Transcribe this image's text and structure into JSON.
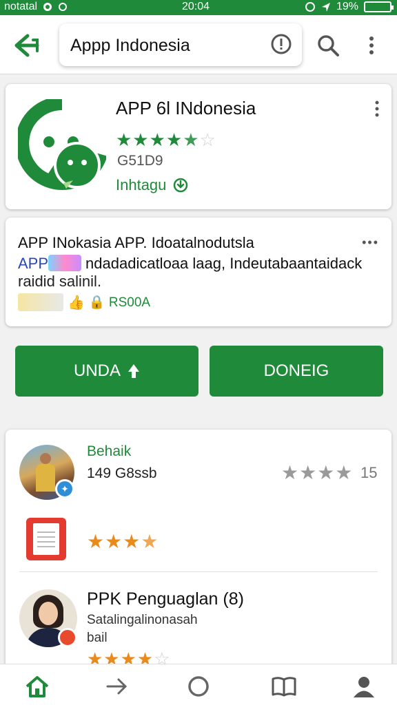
{
  "status_bar": {
    "carrier": "notatal",
    "time": "20:04",
    "battery": "19%"
  },
  "search": {
    "query": "Appp Indonesia"
  },
  "app": {
    "title": "APP 6l INdonesia",
    "rating_stars": 4.5,
    "code": "G51D9",
    "install_label": "Inhtagu"
  },
  "description": {
    "title": "APP INokasia APP. Idoatalnodutsla",
    "more": "•••",
    "app_tag": "APP",
    "line1": "ndadadicatloaa laag, Indeutabaantaidack",
    "line2": "raidid salinil.",
    "badge": "RS00A"
  },
  "buttons": {
    "left_label": "UNDA",
    "right_label": "DONEIG"
  },
  "reviews": [
    {
      "name": "Behaik",
      "subtitle": "149 G8ssb",
      "stars": 4,
      "count": "15"
    },
    {
      "stars": 4
    },
    {
      "name": "PPK Penguaglan (8)",
      "line1": "Satalingalinonasah",
      "line2": "bail",
      "stars": 4.5
    }
  ],
  "colors": {
    "brand_green": "#1f8a3a",
    "star_orange": "#e98a1b",
    "star_gray": "#9a9a9a"
  },
  "icons": {
    "back": "back-arrow-icon",
    "search": "search-icon",
    "info": "info-icon",
    "more": "more-vert-icon",
    "nav": [
      "home-icon",
      "forward-arrow-icon",
      "circle-icon",
      "book-icon",
      "profile-icon"
    ]
  }
}
